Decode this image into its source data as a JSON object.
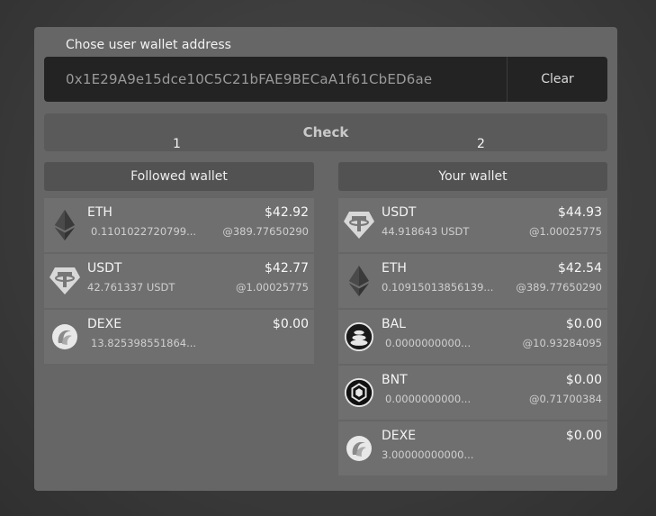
{
  "form": {
    "label": "Chose user wallet address",
    "address": "0x1E29A9e15dce10C5C21bFAE9BECaA1f61CbED6ae",
    "clear_label": "Clear",
    "check_label": "Check"
  },
  "columns": {
    "left_number": "1",
    "right_number": "2",
    "left_title": "Followed wallet",
    "right_title": "Your wallet"
  },
  "followed": [
    {
      "symbol": "ETH",
      "usd": "$42.92",
      "amount": "0.1101022720799...",
      "price": "@389.77650290",
      "icon": "eth-icon"
    },
    {
      "symbol": "USDT",
      "usd": "$42.77",
      "amount": "42.761337 USDT",
      "price": "@1.00025775",
      "icon": "usdt-icon"
    },
    {
      "symbol": "DEXE",
      "usd": "$0.00",
      "amount": "13.825398551864...",
      "price": "",
      "icon": "dexe-icon"
    }
  ],
  "yours": [
    {
      "symbol": "USDT",
      "usd": "$44.93",
      "amount": "44.918643 USDT",
      "price": "@1.00025775",
      "icon": "usdt-icon"
    },
    {
      "symbol": "ETH",
      "usd": "$42.54",
      "amount": "0.10915013856139...",
      "price": "@389.77650290",
      "icon": "eth-icon"
    },
    {
      "symbol": "BAL",
      "usd": "$0.00",
      "amount": "0.0000000000...",
      "price": "@10.93284095",
      "icon": "bal-icon"
    },
    {
      "symbol": "BNT",
      "usd": "$0.00",
      "amount": "0.0000000000...",
      "price": "@0.71700384",
      "icon": "bnt-icon"
    },
    {
      "symbol": "DEXE",
      "usd": "$0.00",
      "amount": "3.00000000000...",
      "price": "",
      "icon": "dexe-icon"
    }
  ]
}
